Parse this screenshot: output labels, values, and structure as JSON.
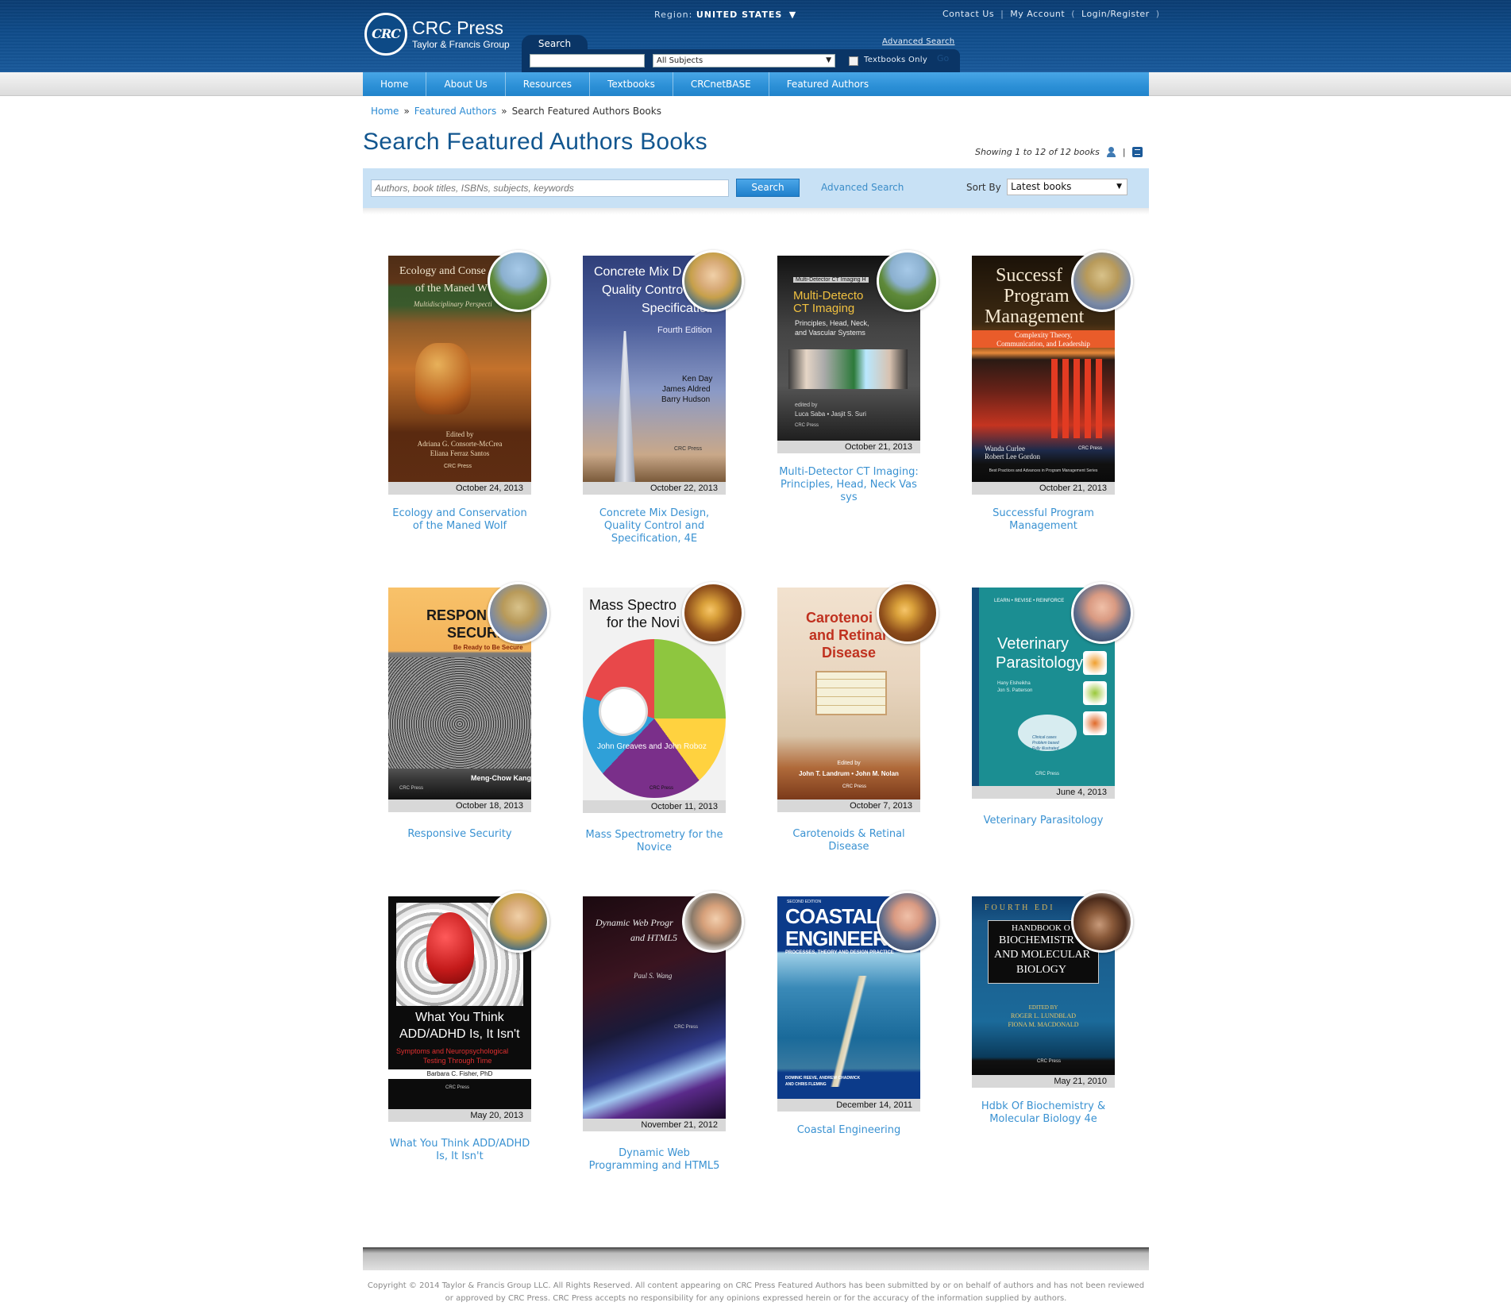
{
  "header": {
    "logo_text": "CRC",
    "logo_name": "CRC Press",
    "logo_sub": "Taylor & Francis Group",
    "region_label": "Region:",
    "region_value": "UNITED STATES",
    "contact": "Contact Us",
    "account": "My Account",
    "login": "Login/Register",
    "search_tab": "Search",
    "advanced_search": "Advanced Search",
    "subjects_select": "All Subjects",
    "textbooks_only": "Textbooks Only",
    "go": "Go"
  },
  "nav": {
    "items": [
      "Home",
      "About Us",
      "Resources",
      "Textbooks",
      "CRCnetBASE",
      "Featured Authors"
    ]
  },
  "breadcrumb": {
    "home": "Home",
    "featured": "Featured Authors",
    "current": "Search Featured Authors Books",
    "sep": "»"
  },
  "page_title": "Search Featured Authors Books",
  "showing": "Showing 1 to 12 of 12 books",
  "showing_sep": "|",
  "search": {
    "placeholder": "Authors, book titles, ISBNs, subjects, keywords",
    "button": "Search",
    "advanced": "Advanced Search",
    "sort_label": "Sort By",
    "sort_value": "Latest books"
  },
  "books": [
    {
      "title": "Ecology and Conservation of the Maned Wolf",
      "date": "October 24, 2013",
      "cover": [
        "Ecology and Conse",
        "of the Maned W",
        "Multidisciplinary Perspecti",
        "Edited by",
        "Adriana G. Consorte-McCrea",
        "Eliana Ferraz Santos"
      ]
    },
    {
      "title": "Concrete Mix Design, Quality Control and Specification, 4E",
      "date": "October 22, 2013",
      "cover": [
        "Concrete Mix D",
        "Quality Contro",
        "Specification",
        "Fourth Edition",
        "Ken Day",
        "James Aldred",
        "Barry Hudson"
      ]
    },
    {
      "title": "Multi-Detector CT Imaging: Principles, Head, Neck Vas sys",
      "date": "October 21, 2013",
      "cover": [
        "Multi-Detector CT Imaging H",
        "Multi-Detecto",
        "CT Imaging",
        "Principles, Head, Neck,",
        "and Vascular Systems",
        "edited by",
        "Luca Saba • Jasjit S. Suri"
      ]
    },
    {
      "title": "Successful Program Management",
      "date": "October 21, 2013",
      "cover": [
        "Successf",
        "Program",
        "Management",
        "Complexity Theory,",
        "Communication, and Leadership",
        "Wanda Curlee",
        "Robert Lee Gordon",
        "Best Practices and Advances in Program Management Series"
      ]
    },
    {
      "title": "Responsive Security",
      "date": "October 18, 2013",
      "cover": [
        "RESPON",
        "SECURI",
        "Be Ready to Be Secure",
        "Meng-Chow Kang"
      ]
    },
    {
      "title": "Mass Spectrometry for the Novice",
      "date": "October 11, 2013",
      "cover": [
        "Mass Spectro",
        "for the Novi",
        "John Greaves and John Roboz"
      ]
    },
    {
      "title": "Carotenoids & Retinal Disease",
      "date": "October 7, 2013",
      "cover": [
        "Carotenoi",
        "and Retinal",
        "Disease",
        "Edited by",
        "John T. Landrum • John M. Nolan"
      ]
    },
    {
      "title": "Veterinary Parasitology",
      "date": "June 4, 2013",
      "cover": [
        "LEARN • REVISE • REINFORCE",
        "Veterinary",
        "Parasitology",
        "Hany Elsheikha",
        "Jon S. Patterson",
        "Clinical cases",
        "Problem based",
        "Fully illustrated"
      ]
    },
    {
      "title": "What You Think ADD/ADHD Is, It Isn't",
      "date": "May 20, 2013",
      "cover": [
        "What You Think",
        "ADD/ADHD Is, It Isn't",
        "Symptoms and Neuropsychological",
        "Testing Through Time",
        "Barbara C. Fisher, PhD"
      ]
    },
    {
      "title": "Dynamic Web Programming and HTML5",
      "date": "November 21, 2012",
      "cover": [
        "Dynamic Web Progr",
        "and HTML5",
        "Paul S. Wang"
      ]
    },
    {
      "title": "Coastal Engineering",
      "date": "December 14, 2011",
      "cover": [
        "SECOND EDITION",
        "COASTAL",
        "ENGINEERI",
        "PROCESSES, THEORY AND DESIGN PRACTICE",
        "DOMINIC REEVE, ANDREW CHADWICK",
        "AND CHRIS FLEMING"
      ]
    },
    {
      "title": "Hdbk Of Biochemistry & Molecular Biology 4e",
      "date": "May 21, 2010",
      "cover": [
        "FOURTH EDI",
        "HANDBOOK O",
        "BIOCHEMISTR",
        "AND MOLECULAR",
        "BIOLOGY",
        "EDITED BY",
        "ROGER L. LUNDBLAD",
        "FIONA M. MACDONALD"
      ]
    }
  ],
  "publisher_mark": "CRC Press",
  "footer": {
    "copyright": "Copyright © 2014 Taylor & Francis Group LLC. All Rights Reserved. All content appearing on CRC Press Featured Authors has been submitted by or on behalf of authors and has not been reviewed or approved by CRC Press. CRC Press accepts no responsibility for any opinions expressed herein or for the accuracy of the information supplied by authors."
  },
  "icons": {
    "region_dropdown": "chevron-down-icon",
    "user": "user-icon",
    "book": "book-icon"
  }
}
